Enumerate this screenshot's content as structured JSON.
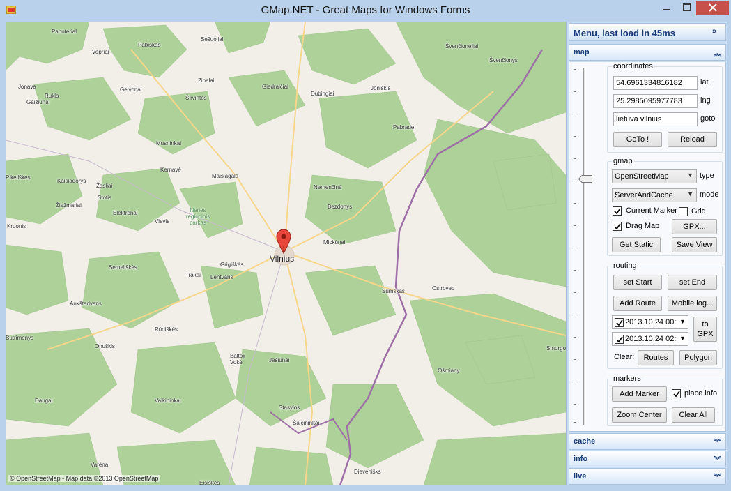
{
  "window": {
    "title": "GMap.NET - Great Maps for Windows Forms"
  },
  "map": {
    "attribution": "© OpenStreetMap - Map data ©2013 OpenStreetMap",
    "city": "Vilnius",
    "places": [
      "Panoterial",
      "Vepriai",
      "Pabiskas",
      "Sešuolial",
      "Švenčionėliai",
      "Zibalai",
      "Jonava",
      "Gelvonai",
      "Giedraičiai",
      "Joniškis",
      "Švenčionys",
      "Rukla",
      "Gaižiūnai",
      "Širvintos",
      "Dubingiai",
      "Pabrade",
      "Musninkai",
      "Kernavė",
      "Maisiagala",
      "Kaišiadorys",
      "Žasliai",
      "Pikeliškės",
      "Stotis",
      "Nemenčinė",
      "Žiežmariai",
      "Elektrėnai",
      "Bezdonys",
      "Kruonis",
      "Vievis",
      "Mickūnai",
      "Semeliškės",
      "Grigiškės",
      "Trakai",
      "Lentvaris",
      "Sumskas",
      "Ostrovec",
      "Aukštadvaris",
      "Rūdiškės",
      "Butrimonys",
      "Onuškis",
      "Baltoji Vokė",
      "Jašiūnai",
      "Smorgon",
      "Ošmiany",
      "Daugai",
      "Valkininkai",
      "Stasylos",
      "Šalčininkai",
      "Varėna",
      "Dievenišks",
      "Eišiškės",
      "Širvintos"
    ],
    "park_label": "Neries regioninis parkas"
  },
  "panel": {
    "header": "Menu, last load in 45ms",
    "sections": {
      "map": "map",
      "cache": "cache",
      "info": "info",
      "live": "live"
    },
    "coordinates": {
      "title": "coordinates",
      "lat_value": "54.6961334816182",
      "lat_label": "lat",
      "lng_value": "25.2985095977783",
      "lng_label": "lng",
      "goto_value": "lietuva vilnius",
      "goto_label": "goto",
      "goto_button": "GoTo !",
      "reload_button": "Reload"
    },
    "gmap": {
      "title": "gmap",
      "type_value": "OpenStreetMap",
      "type_label": "type",
      "mode_value": "ServerAndCache",
      "mode_label": "mode",
      "current_marker": "Current Marker",
      "current_marker_checked": true,
      "grid": "Grid",
      "grid_checked": false,
      "drag_map": "Drag Map",
      "drag_map_checked": true,
      "gpx_button": "GPX...",
      "get_static_button": "Get Static",
      "save_view_button": "Save View"
    },
    "routing": {
      "title": "routing",
      "set_start": "set Start",
      "set_end": "set End",
      "add_route": "Add Route",
      "mobile_log": "Mobile log...",
      "date1": "2013.10.24 00:",
      "date2": "2013.10.24 02:",
      "to_gpx": "to GPX",
      "clear_label": "Clear:",
      "routes_button": "Routes",
      "polygon_button": "Polygon"
    },
    "markers": {
      "title": "markers",
      "add_marker": "Add Marker",
      "place_info": "place info",
      "place_info_checked": true,
      "zoom_center": "Zoom Center",
      "clear_all": "Clear All"
    }
  },
  "colors": {
    "forest": "#aed19a",
    "forest_dark": "#9cc486",
    "border": "#9d6fa6",
    "road": "#f7d68a",
    "close": "#c7504a"
  }
}
